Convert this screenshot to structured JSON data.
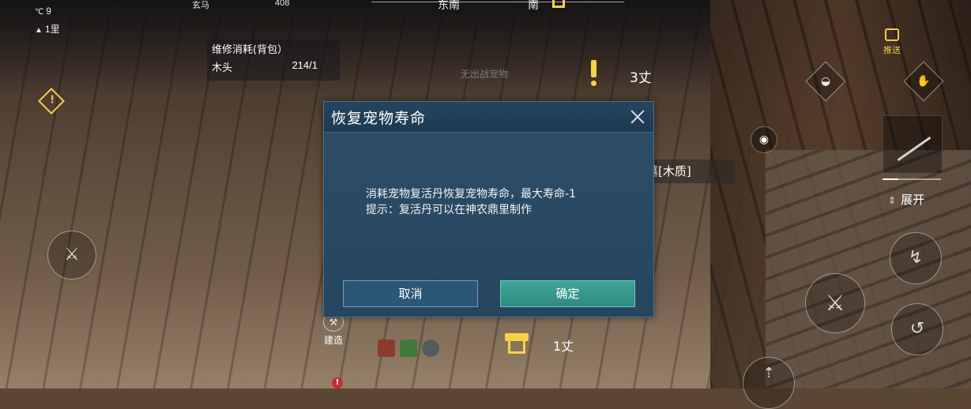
{
  "status": {
    "temp_icon": "thermometer-icon",
    "temperature": "9",
    "distance_icon": "mountain-icon",
    "distance": "1里",
    "top_name": "玄马",
    "top_value": "408"
  },
  "compass": {
    "dir1": "东南",
    "dir2": "南"
  },
  "repair": {
    "title": "维修消耗(背包）",
    "item": "木头",
    "count": "214/1"
  },
  "world": {
    "no_pet": "无出战宠物",
    "quest_distance": "3丈",
    "object_tag": "墓[木质]",
    "gate_distance": "1丈"
  },
  "hud": {
    "push_label": "推送",
    "expand_label": "展开",
    "build_label": "建造"
  },
  "dialog": {
    "title": "恢复宠物寿命",
    "line1": "消耗宠物复活丹恢复宠物寿命，最大寿命-1",
    "line2": "提示：复活丹可以在神农鼎里制作",
    "cancel": "取消",
    "confirm": "确定"
  },
  "colors": {
    "dialog_bg": "#2e4e68",
    "confirm_btn": "#3fa597",
    "accent_yellow": "#f6d346"
  }
}
